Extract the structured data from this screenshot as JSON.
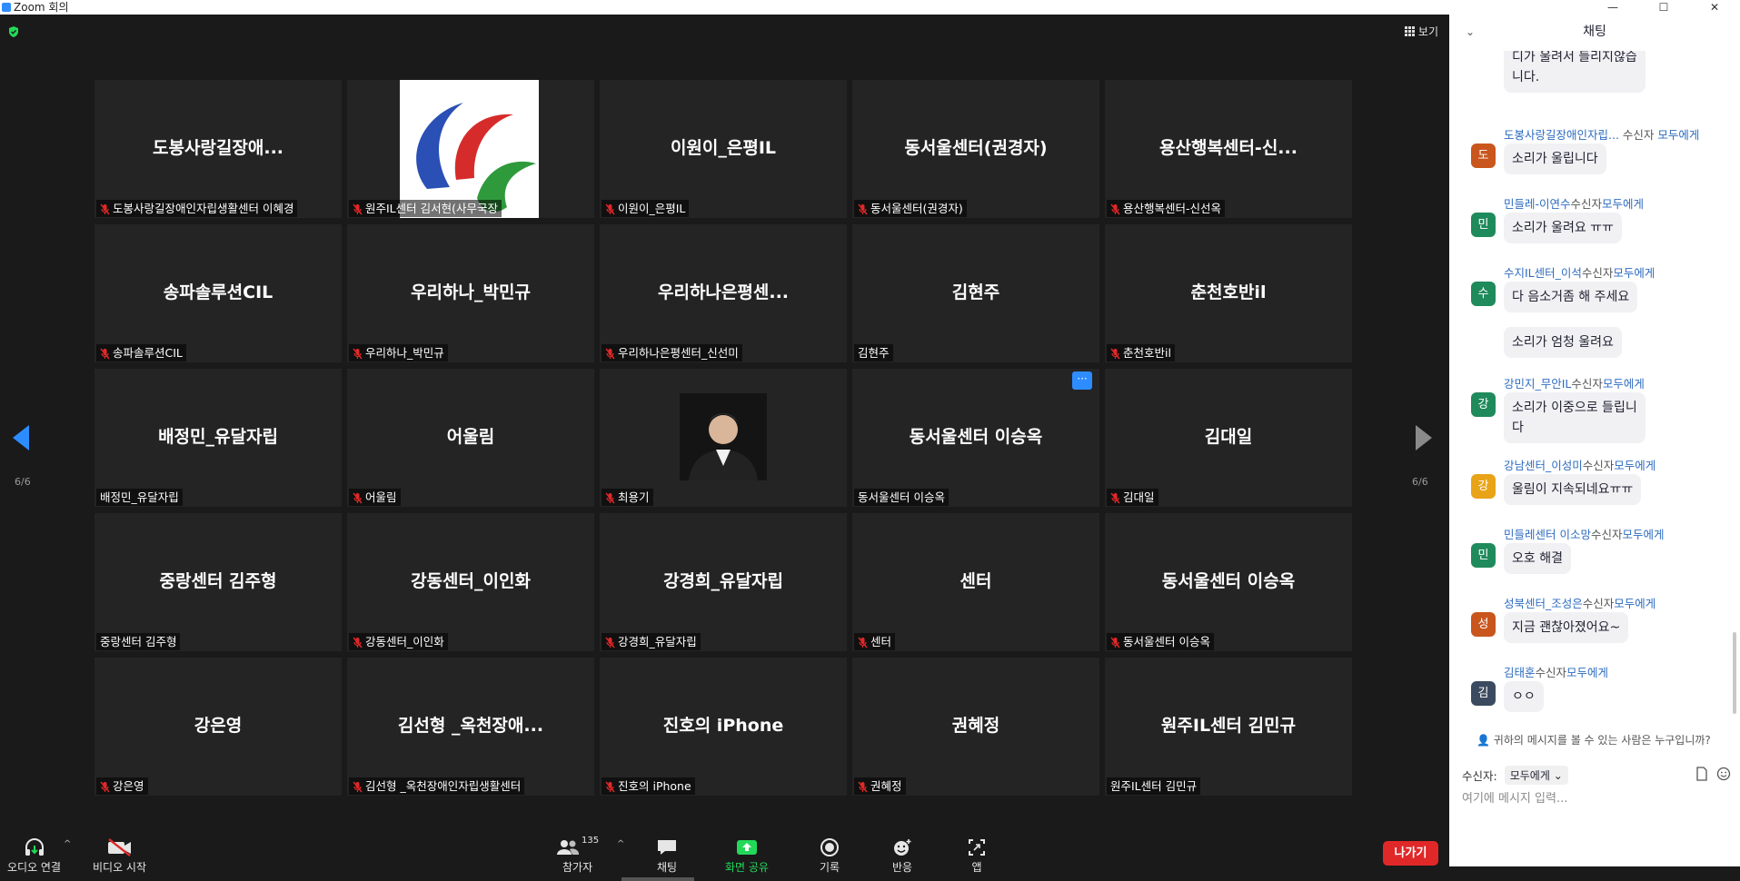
{
  "window": {
    "title": "Zoom 회의",
    "controls": [
      "—",
      "☐",
      "✕"
    ]
  },
  "meeting": {
    "view_label": "보기",
    "page_indicator_left": "6/6",
    "page_indicator_right": "6/6"
  },
  "tiles": [
    {
      "big": "도봉사랑길장애...",
      "label": "도봉사랑길장애인자립생활센터 이혜경",
      "muted": true
    },
    {
      "big": "",
      "label": "원주IL센터 김서현(사무국장",
      "muted": true
    },
    {
      "big": "이원이_은평IL",
      "label": "이원이_은평IL",
      "muted": true
    },
    {
      "big": "동서울센터(권경자)",
      "label": "동서울센터(권경자)",
      "muted": true
    },
    {
      "big": "용산행복센터-신...",
      "label": "용산행복센터-신선옥",
      "muted": true
    },
    {
      "big": "송파솔루션CIL",
      "label": "송파솔루션CIL",
      "muted": true
    },
    {
      "big": "우리하나_박민규",
      "label": "우리하나_박민규",
      "muted": true
    },
    {
      "big": "우리하나은평센...",
      "label": "우리하나은평센터_신선미",
      "muted": true
    },
    {
      "big": "김현주",
      "label": "김현주",
      "muted": false
    },
    {
      "big": "춘천호반il",
      "label": "춘천호반il",
      "muted": true
    },
    {
      "big": "배정민_유달자립",
      "label": "배정민_유달자립",
      "muted": false
    },
    {
      "big": "어울림",
      "label": "어울림",
      "muted": true
    },
    {
      "big": "",
      "label": "최용기",
      "muted": true
    },
    {
      "big": "동서울센터 이승옥",
      "label": "동서울센터 이승옥",
      "muted": false
    },
    {
      "big": "김대일",
      "label": "김대일",
      "muted": true
    },
    {
      "big": "중랑센터 김주형",
      "label": "중랑센터 김주형",
      "muted": false
    },
    {
      "big": "강동센터_이인화",
      "label": "강동센터_이인화",
      "muted": true
    },
    {
      "big": "강경희_유달자립",
      "label": "강경희_유달자립",
      "muted": true
    },
    {
      "big": "센터",
      "label": "센터",
      "muted": true
    },
    {
      "big": "동서울센터 이승옥",
      "label": "동서울센터 이승옥",
      "muted": true
    },
    {
      "big": "강은영",
      "label": "강은영",
      "muted": true
    },
    {
      "big": "김선형 _옥천장애...",
      "label": "김선형 _옥천장애인자립생활센터",
      "muted": true
    },
    {
      "big": "진호의 iPhone",
      "label": "진호의 iPhone",
      "muted": true
    },
    {
      "big": "권혜정",
      "label": "권혜정",
      "muted": true
    },
    {
      "big": "원주IL센터 김민규",
      "label": "원주IL센터 김민규",
      "muted": false
    }
  ],
  "toolbar": {
    "audio": "오디오 연결",
    "video": "비디오 시작",
    "participants": "참가자",
    "participants_count": "135",
    "chat": "채팅",
    "share": "화면 공유",
    "record": "기록",
    "reactions": "반응",
    "apps": "앱",
    "leave": "나가기"
  },
  "chat": {
    "title": "채팅",
    "partial_text_1": "디가 울려서 들리지않습",
    "partial_text_2": "니다.",
    "messages": [
      {
        "name": "도봉사랑길장애인자립...",
        "to_prefix": " 수신자 ",
        "to": "모두에게",
        "avatar": "도",
        "color": "#c9561d",
        "lines": [
          "소리가 울립니다"
        ]
      },
      {
        "name": "민들레-이연수",
        "to_prefix": "수신자",
        "to": "모두에게",
        "avatar": "민",
        "color": "#1f8a5b",
        "lines": [
          "소리가 울려요 ㅠㅠ"
        ]
      },
      {
        "name": "수지IL센터_이석",
        "to_prefix": "수신자",
        "to": "모두에게",
        "avatar": "수",
        "color": "#1f8a5b",
        "lines": [
          "다 음소거좀 해 주세요",
          "소리가 엄청 울려요"
        ]
      },
      {
        "name": "강민지_무안IL",
        "to_prefix": "수신자",
        "to": "모두에게",
        "avatar": "강",
        "color": "#1f8a5b",
        "lines": [
          "소리가 이중으로 들립니",
          "다"
        ]
      },
      {
        "name": "강남센터_이성미",
        "to_prefix": "수신자",
        "to": "모두에게",
        "avatar": "강",
        "color": "#e8a317",
        "lines": [
          "울림이 지속되네요ㅠㅠ"
        ]
      },
      {
        "name": "민들레센터 이소망",
        "to_prefix": "수신자",
        "to": "모두에게",
        "avatar": "민",
        "color": "#1f8a5b",
        "lines": [
          "오호 해결"
        ]
      },
      {
        "name": "성북센터_조성은",
        "to_prefix": "수신자",
        "to": "모두에게",
        "avatar": "성",
        "color": "#c9561d",
        "lines": [
          "지금 괜찮아졌어요~"
        ]
      },
      {
        "name": "김태훈",
        "to_prefix": "수신자",
        "to": "모두에게",
        "avatar": "김",
        "color": "#3b4a5e",
        "lines": [
          "ㅇㅇ"
        ]
      }
    ],
    "who_can_see": "귀하의 메시지를 볼 수 있는 사람은 누구입니까?",
    "to_label": "수신자:",
    "to_value": "모두에게",
    "input_placeholder": "여기에 메시지 입력..."
  },
  "colors": {
    "accent": "#2d8cff",
    "leave": "#e02828",
    "share": "#23d959",
    "tile_bg": "#242424"
  }
}
